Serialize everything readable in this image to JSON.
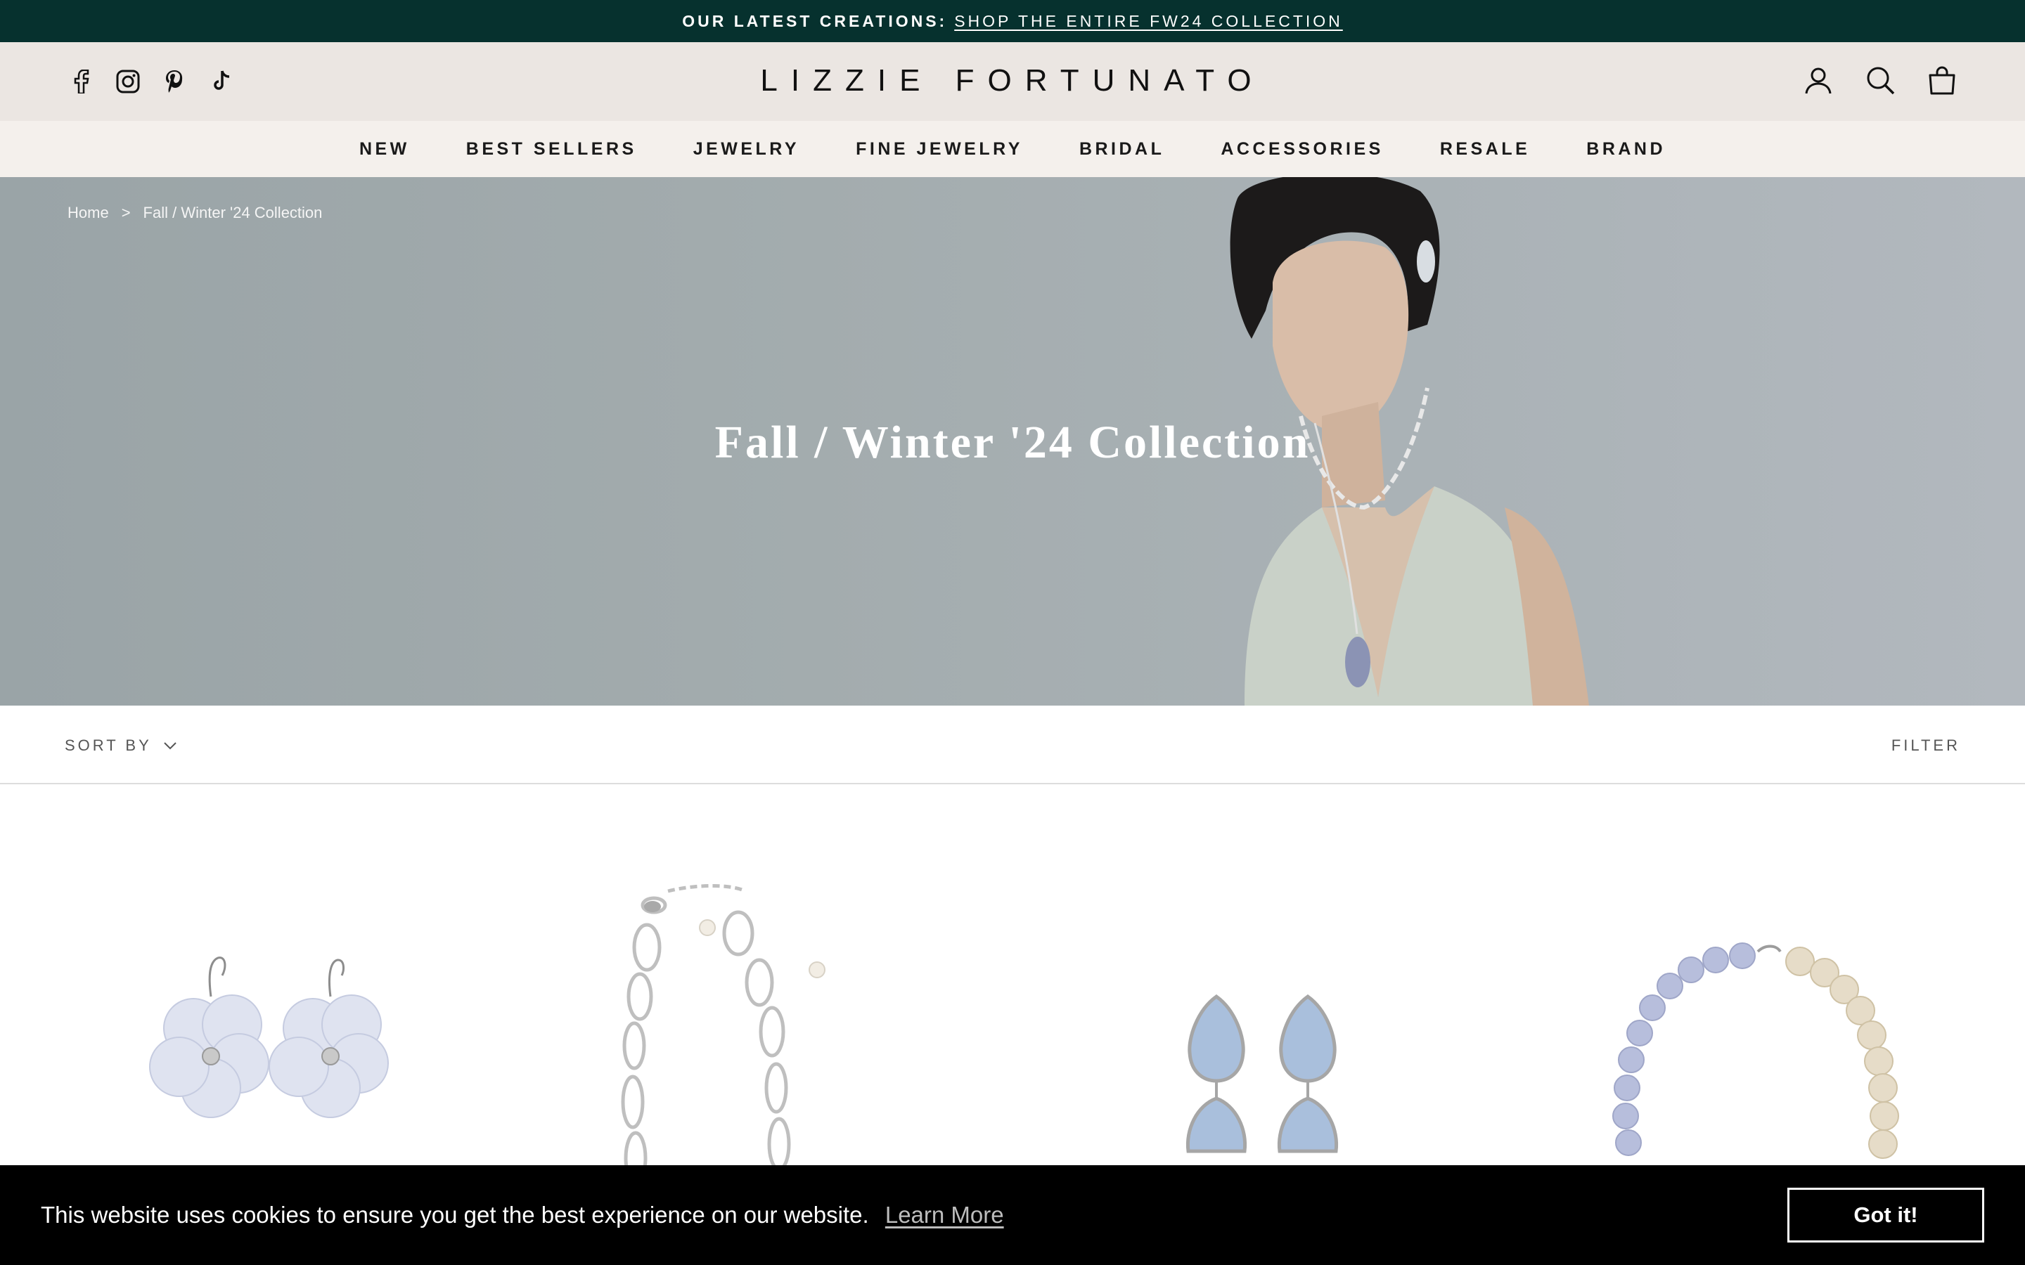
{
  "announcement": {
    "lead": "OUR LATEST CREATIONS:",
    "link": "SHOP THE ENTIRE FW24 COLLECTION"
  },
  "header": {
    "logo": "LIZZIE FORTUNATO",
    "social_icons": [
      "facebook-icon",
      "instagram-icon",
      "pinterest-icon",
      "tiktok-icon"
    ],
    "util_icons": [
      "account-icon",
      "search-icon",
      "bag-icon"
    ]
  },
  "nav": {
    "items": [
      "NEW",
      "BEST SELLERS",
      "JEWELRY",
      "FINE JEWELRY",
      "BRIDAL",
      "ACCESSORIES",
      "RESALE",
      "BRAND"
    ]
  },
  "breadcrumb": {
    "home": "Home",
    "sep": ">",
    "current": "Fall / Winter '24 Collection"
  },
  "hero": {
    "title": "Fall / Winter '24 Collection"
  },
  "toolbar": {
    "sort_label": "SORT BY",
    "filter_label": "FILTER"
  },
  "cookie": {
    "message": "This website uses cookies to ensure you get the best experience on our website.",
    "learn_more": "Learn More",
    "button": "Got it!"
  },
  "colors": {
    "announcement_bg": "#06312e",
    "header_bg": "#ebe6e2",
    "nav_bg": "#f4f0ec",
    "cookie_bg": "#000000"
  }
}
